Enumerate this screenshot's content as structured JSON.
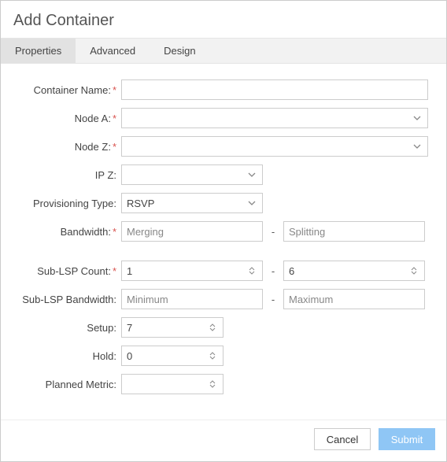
{
  "dialog": {
    "title": "Add Container"
  },
  "tabs": {
    "properties": "Properties",
    "advanced": "Advanced",
    "design": "Design",
    "active": "properties"
  },
  "labels": {
    "containerName": "Container Name:",
    "nodeA": "Node A:",
    "nodeZ": "Node Z:",
    "ipZ": "IP Z:",
    "provisioningType": "Provisioning Type:",
    "bandwidth": "Bandwidth:",
    "subLspCount": "Sub-LSP Count:",
    "subLspBandwidth": "Sub-LSP Bandwidth:",
    "setup": "Setup:",
    "hold": "Hold:",
    "plannedMetric": "Planned Metric:"
  },
  "values": {
    "containerName": "",
    "nodeA": "",
    "nodeZ": "",
    "ipZ": "",
    "provisioningType": "RSVP",
    "bandwidthMerging": "Merging",
    "bandwidthSplitting": "Splitting",
    "subLspCountMin": "1",
    "subLspCountMax": "6",
    "subLspBwMin": "Minimum",
    "subLspBwMax": "Maximum",
    "setup": "7",
    "hold": "0",
    "plannedMetric": ""
  },
  "separator": "-",
  "buttons": {
    "cancel": "Cancel",
    "submit": "Submit"
  }
}
